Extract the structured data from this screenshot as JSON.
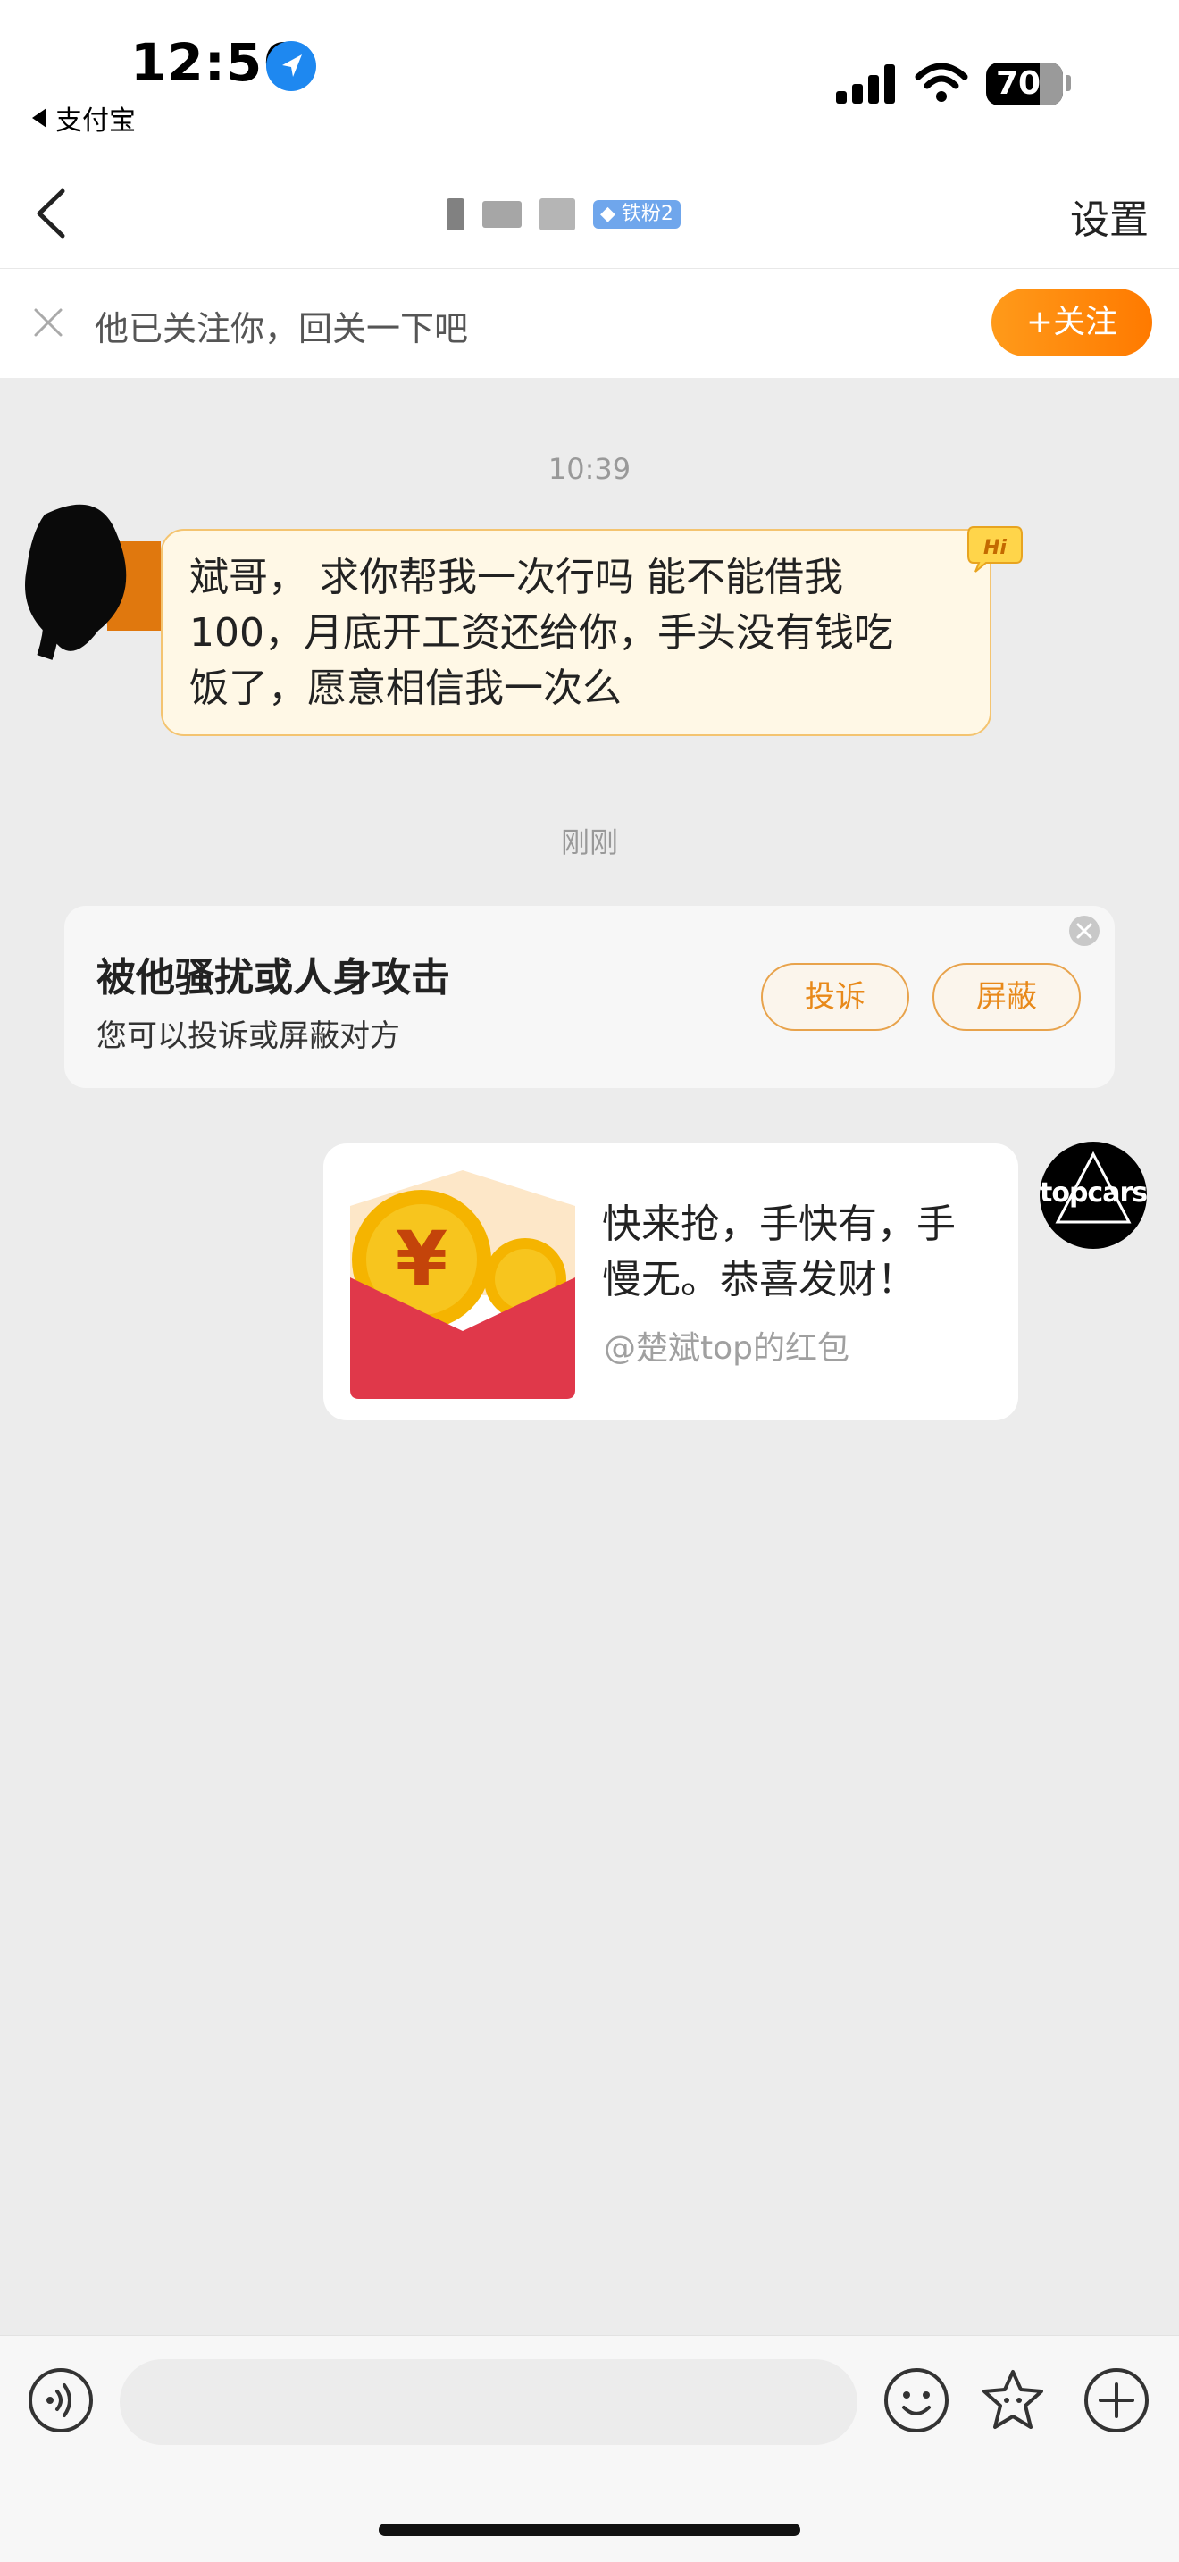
{
  "status_bar": {
    "time": "12:56",
    "back_app": "支付宝",
    "battery": "70"
  },
  "nav": {
    "title_badge": "铁粉2",
    "settings": "设置"
  },
  "follow_bar": {
    "text": "他已关注你，回关一下吧",
    "button": "+关注"
  },
  "chat": {
    "timestamp_1": "10:39",
    "message_1": {
      "line_1": "斌哥， 求你帮我一次行吗  能不能借我",
      "line_2": "100，月底开工资还给你，手头没有钱吃",
      "line_3": "饭了，愿意相信我一次么",
      "badge": "Hi"
    },
    "timestamp_2": "刚刚",
    "warning": {
      "title": "被他骚扰或人身攻击",
      "subtitle": "您可以投诉或屏蔽对方",
      "complain_button": "投诉",
      "block_button": "屏蔽"
    },
    "red_packet": {
      "line_1": "快来抢，手快有，手",
      "line_2": "慢无。恭喜发财！",
      "from": "@楚斌top的红包",
      "currency_symbol": "¥"
    },
    "sender_avatar_text": "topcars"
  },
  "input_bar": {
    "placeholder": ""
  },
  "colors": {
    "accent_orange": "#ff8a00",
    "badge_blue": "#6fa6ec",
    "bubble_bg": "#fff8e6",
    "red_packet": "#e0384a"
  }
}
